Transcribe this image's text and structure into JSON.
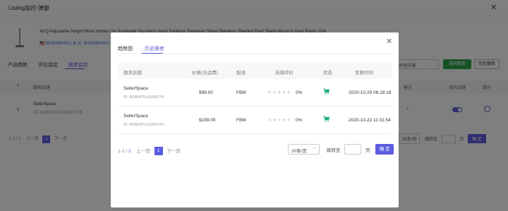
{
  "background": {
    "title": "Listing监控-弹窗",
    "close_glyph": "✕",
    "product_name": "AUQ Adjustable Height Metal Holders for Sunshade Touchless Hand Sanitizer Dispenser Stand Stainless Steering Floor Stand Mount in Door Room USA",
    "asin_line": "🇺🇸 B08D9BH921 ⧉  父: B08D9BH921",
    "tabs": [
      {
        "label": "产品趋势",
        "active": false
      },
      {
        "label": "评论监控",
        "active": false
      },
      {
        "label": "跟卖监控",
        "active": true
      }
    ],
    "store_select": "所有店铺",
    "btn_current": "当前跟卖",
    "btn_history": "历史跟卖",
    "columns": {
      "index": "#",
      "store": "跟卖店铺",
      "remark": "备注",
      "mine": "我的店铺",
      "action": "操作"
    },
    "row": {
      "index": "1",
      "store": "SellerSpace",
      "sid": "ID: A39EKPL0Q6WJTH ⧉",
      "remark": "/"
    },
    "pager": {
      "summary": "1-1 / 1",
      "prev": "上一页",
      "page": "1",
      "next": "下一页"
    },
    "pager_right": {
      "size": "30条/页",
      "jump": "跳转至",
      "page_unit": "页",
      "go": "确 定"
    }
  },
  "modal": {
    "close_glyph": "✕",
    "tabs": [
      {
        "label": "趋势图",
        "active": false
      },
      {
        "label": "历史跟卖",
        "active": true
      }
    ],
    "columns": {
      "store": "跟卖店铺",
      "price": "价格(含运费)",
      "shipping": "配送",
      "rating": "店铺评价",
      "status": "状态",
      "change_time": "变更时间"
    },
    "rows": [
      {
        "store": "SellerSpace",
        "sid": "ID: A39EKPL0Q6WJTH",
        "price": "$99.00",
        "shipping": "FBM",
        "stars": "★★★★★",
        "rating_pct": "0%",
        "time": "2020-10-29 06:18:18"
      },
      {
        "store": "SellerSpace",
        "sid": "ID: A39EKPL0Q6WJTH",
        "price": "$199.00",
        "shipping": "FBM",
        "stars": "★★★★★",
        "rating_pct": "0%",
        "time": "2020-10-22 11:31:54"
      }
    ],
    "pager": {
      "range": "1-2",
      "sep": " / ",
      "total": "2",
      "prev": "上一页",
      "page": "1",
      "next": "下一页",
      "size": "30条/页",
      "jump": "跳转至",
      "page_unit": "页",
      "go": "确 定"
    }
  },
  "colors": {
    "accent": "#5c5ce0",
    "cart_icon": "#23b07d",
    "green_button": "#2fa54a"
  }
}
